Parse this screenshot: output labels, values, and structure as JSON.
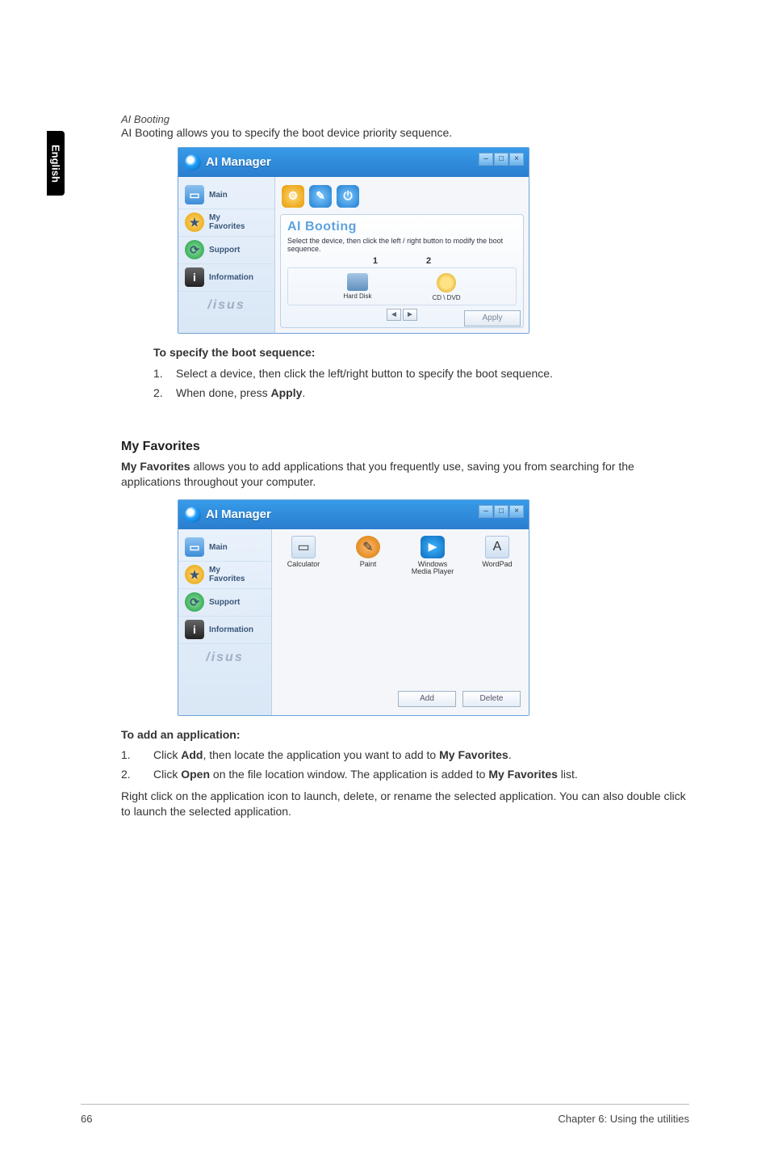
{
  "side_tab": "English",
  "sec1": {
    "heading_it": "AI Booting",
    "desc": "AI Booting allows you to specify the boot device priority sequence.",
    "sub_heading": "To specify the boot sequence:",
    "steps": [
      {
        "n": "1.",
        "t": "Select a device, then click the left/right button to specify the boot sequence."
      },
      {
        "n": "2.",
        "t_prefix": "When done, press ",
        "t_bold": "Apply",
        "t_suffix": "."
      }
    ]
  },
  "sec2": {
    "heading": "My Favorites",
    "desc_prefix_bold": "My Favorites",
    "desc_rest": " allows you to add applications that you frequently use, saving you from searching for the applications throughout your computer.",
    "sub_heading": "To add an application:",
    "steps": [
      {
        "n": "1.",
        "prefix": "Click ",
        "b1": "Add",
        "mid": ", then locate the application you want to add to ",
        "b2": "My Favorites",
        "suffix": "."
      },
      {
        "n": "2.",
        "prefix": "Click ",
        "b1": "Open",
        "mid": " on the file location window. The application is added to ",
        "b2": "My Favorites",
        "suffix": " list."
      }
    ],
    "post": "Right click on the application icon to launch, delete, or rename the selected application. You can also double click to launch the selected application."
  },
  "win_common": {
    "title": "AI Manager",
    "min": "–",
    "max": "□",
    "close": "×",
    "asus": "/isus"
  },
  "win1": {
    "sidebar": [
      {
        "label": "Main"
      },
      {
        "label": "My\nFavorites"
      },
      {
        "label": "Support"
      },
      {
        "label": "Information"
      }
    ],
    "panel_title": "AI Booting",
    "panel_sub": "Select the device, then click the left / right button to modify the boot sequence.",
    "cols": [
      "1",
      "2"
    ],
    "devices": [
      {
        "label": "Hard Disk"
      },
      {
        "label": "CD \\ DVD"
      }
    ],
    "left": "◄",
    "right": "►",
    "apply": "Apply"
  },
  "win2": {
    "sidebar": [
      {
        "label": "Main"
      },
      {
        "label": "My\nFavorites"
      },
      {
        "label": "Support"
      },
      {
        "label": "Information"
      }
    ],
    "apps": [
      {
        "label": "Calculator"
      },
      {
        "label": "Paint"
      },
      {
        "label": "Windows\nMedia Player"
      },
      {
        "label": "WordPad"
      }
    ],
    "add": "Add",
    "delete": "Delete"
  },
  "footer": {
    "page": "66",
    "chapter": "Chapter 6: Using the utilities"
  }
}
